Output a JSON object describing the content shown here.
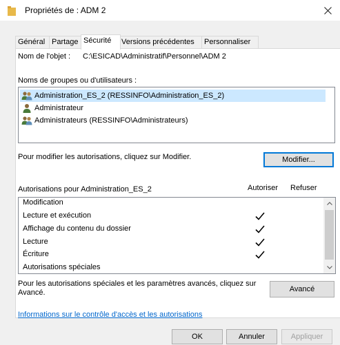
{
  "window": {
    "title": "Propriétés de : ADM 2",
    "close_icon": "close-icon"
  },
  "tabs": [
    {
      "label": "Général"
    },
    {
      "label": "Partage"
    },
    {
      "label": "Sécurité"
    },
    {
      "label": "Versions précédentes"
    },
    {
      "label": "Personnaliser"
    }
  ],
  "object": {
    "label": "Nom de l'objet :",
    "value": "C:\\ESICAD\\Administratif\\Personnel\\ADM 2"
  },
  "groups": {
    "label": "Noms de groupes ou d'utilisateurs :",
    "items": [
      {
        "name": "Administration_ES_2 (RESSINFO\\Administration_ES_2)",
        "icon": "group-icon"
      },
      {
        "name": "Administrateur",
        "icon": "user-icon"
      },
      {
        "name": "Administrateurs (RESSINFO\\Administrateurs)",
        "icon": "group-icon"
      }
    ]
  },
  "modify": {
    "text": "Pour modifier les autorisations, cliquez sur Modifier.",
    "button": "Modifier..."
  },
  "permissions": {
    "title": "Autorisations pour Administration_ES_2",
    "allow_header": "Autoriser",
    "deny_header": "Refuser",
    "rows": [
      {
        "name": "Modification",
        "allow": false,
        "deny": false
      },
      {
        "name": "Lecture et exécution",
        "allow": true,
        "deny": false
      },
      {
        "name": "Affichage du contenu du dossier",
        "allow": true,
        "deny": false
      },
      {
        "name": "Lecture",
        "allow": true,
        "deny": false
      },
      {
        "name": "Écriture",
        "allow": true,
        "deny": false
      },
      {
        "name": "Autorisations spéciales",
        "allow": false,
        "deny": false
      }
    ]
  },
  "advanced": {
    "text_line1": "Pour les autorisations spéciales et les paramètres avancés, cliquez sur",
    "text_line2": "Avancé.",
    "button": "Avancé"
  },
  "info_link": "Informations sur le contrôle d'accès et les autorisations",
  "footer": {
    "ok": "OK",
    "cancel": "Annuler",
    "apply": "Appliquer"
  },
  "colors": {
    "selection": "#cce8ff",
    "link": "#0066cc",
    "focus_border": "#0078d7"
  }
}
